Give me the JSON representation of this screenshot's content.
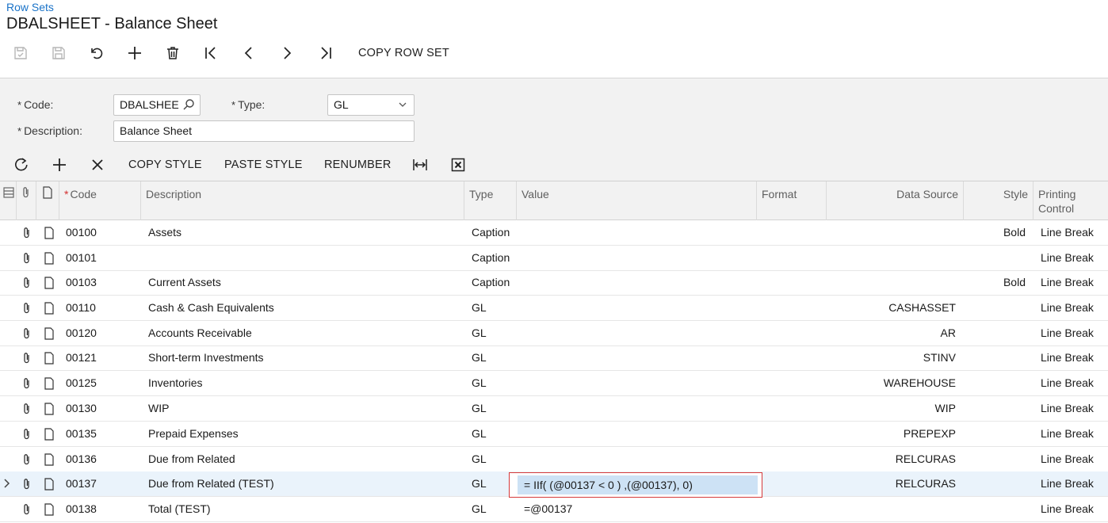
{
  "breadcrumb": "Row Sets",
  "title": "DBALSHEET - Balance Sheet",
  "toolbar": {
    "copy_row_set": "COPY ROW SET"
  },
  "form": {
    "code_label": "Code:",
    "code_value": "DBALSHEE",
    "type_label": "Type:",
    "type_value": "GL",
    "description_label": "Description:",
    "description_value": "Balance Sheet",
    "required_mark": "*"
  },
  "grid_toolbar": {
    "copy_style": "COPY STYLE",
    "paste_style": "PASTE STYLE",
    "renumber": "RENUMBER"
  },
  "columns": {
    "code": "Code",
    "description": "Description",
    "type": "Type",
    "value": "Value",
    "format": "Format",
    "data_source": "Data Source",
    "style": "Style",
    "printing_control_1": "Printing",
    "printing_control_2": "Control"
  },
  "rows": [
    {
      "code": "00100",
      "description": "Assets",
      "type": "Caption",
      "value": "",
      "format": "",
      "data_source": "",
      "style": "Bold",
      "printing": "Line Break"
    },
    {
      "code": "00101",
      "description": "",
      "type": "Caption",
      "value": "",
      "format": "",
      "data_source": "",
      "style": "",
      "printing": "Line Break"
    },
    {
      "code": "00103",
      "description": "Current Assets",
      "type": "Caption",
      "value": "",
      "format": "",
      "data_source": "",
      "style": "Bold",
      "printing": "Line Break"
    },
    {
      "code": "00110",
      "description": "Cash & Cash Equivalents",
      "type": "GL",
      "value": "",
      "format": "",
      "data_source": "CASHASSET",
      "style": "",
      "printing": "Line Break"
    },
    {
      "code": "00120",
      "description": "Accounts Receivable",
      "type": "GL",
      "value": "",
      "format": "",
      "data_source": "AR",
      "style": "",
      "printing": "Line Break"
    },
    {
      "code": "00121",
      "description": "Short-term Investments",
      "type": "GL",
      "value": "",
      "format": "",
      "data_source": "STINV",
      "style": "",
      "printing": "Line Break"
    },
    {
      "code": "00125",
      "description": "Inventories",
      "type": "GL",
      "value": "",
      "format": "",
      "data_source": "WAREHOUSE",
      "style": "",
      "printing": "Line Break"
    },
    {
      "code": "00130",
      "description": "WIP",
      "type": "GL",
      "value": "",
      "format": "",
      "data_source": "WIP",
      "style": "",
      "printing": "Line Break"
    },
    {
      "code": "00135",
      "description": "Prepaid Expenses",
      "type": "GL",
      "value": "",
      "format": "",
      "data_source": "PREPEXP",
      "style": "",
      "printing": "Line Break"
    },
    {
      "code": "00136",
      "description": "Due from Related",
      "type": "GL",
      "value": "",
      "format": "",
      "data_source": "RELCURAS",
      "style": "",
      "printing": "Line Break"
    },
    {
      "code": "00137",
      "description": "Due from Related (TEST)",
      "type": "GL",
      "value": "",
      "format": "",
      "data_source": "RELCURAS",
      "style": "",
      "printing": "Line Break"
    },
    {
      "code": "00138",
      "description": "Total (TEST)",
      "type": "GL",
      "value": "=@00137",
      "format": "",
      "data_source": "",
      "style": "",
      "printing": "Line Break"
    }
  ],
  "editing_value": "= IIf( (@00137 < 0 ) ,(@00137), 0)",
  "colors": {
    "link": "#1a73c8",
    "required": "#d32f2f",
    "selected_row": "#eaf3fb",
    "editor_border": "#d63a3a",
    "editor_fill": "#cde2f5"
  }
}
